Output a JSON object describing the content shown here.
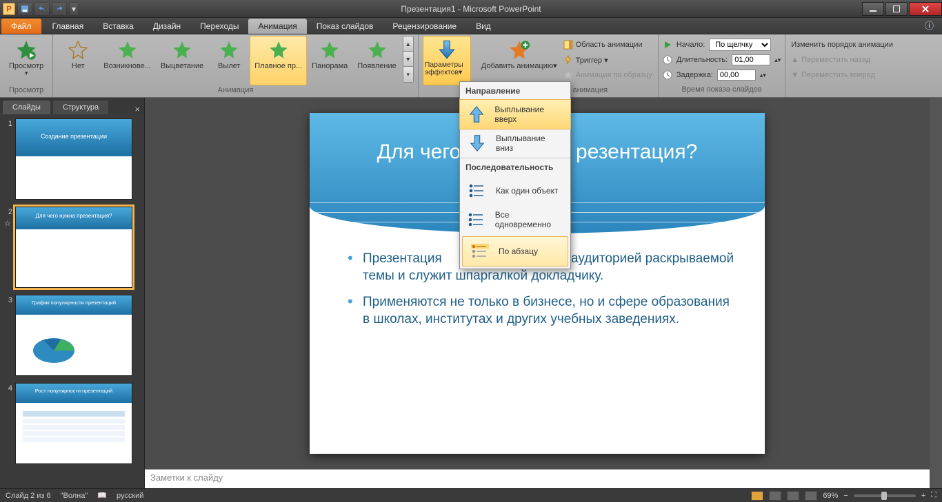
{
  "titlebar": {
    "title": "Презентация1 - Microsoft PowerPoint",
    "app_letter": "P"
  },
  "tabs": {
    "file": "Файл",
    "items": [
      "Главная",
      "Вставка",
      "Дизайн",
      "Переходы",
      "Анимация",
      "Показ слайдов",
      "Рецензирование",
      "Вид"
    ],
    "active_index": 4
  },
  "ribbon": {
    "preview": {
      "button": "Просмотр",
      "caption": "Просмотр"
    },
    "animation_group": {
      "caption": "Анимация",
      "items": [
        "Нет",
        "Возникнове...",
        "Выцветание",
        "Вылет",
        "Плавное пр...",
        "Панорама",
        "Появление"
      ],
      "active_index": 4
    },
    "effect_options": {
      "label": "Параметры эффектов▾"
    },
    "advanced": {
      "add": "Добавить анимацию▾",
      "pane": "Область анимации",
      "trigger": "Триггер ▾",
      "painter": "Анимация по образцу",
      "caption": "Расширенная анимация"
    },
    "timing": {
      "start_label": "Начало:",
      "start_value": "По щелчку",
      "duration_label": "Длительность:",
      "duration_value": "01,00",
      "delay_label": "Задержка:",
      "delay_value": "00,00",
      "caption": "Время показа слайдов"
    },
    "reorder": {
      "title": "Изменить порядок анимации",
      "earlier": "Переместить назад",
      "later": "Переместить вперед"
    }
  },
  "popup": {
    "section1": "Направление",
    "opt_up": "Выплывание вверх",
    "opt_down": "Выплывание вниз",
    "section2": "Последовательность",
    "opt_as_one": "Как один объект",
    "opt_all_at_once": "Все одновременно",
    "opt_by_paragraph": "По абзацу"
  },
  "slidepanel": {
    "tab_slides": "Слайды",
    "tab_outline": "Структура",
    "thumbs": [
      {
        "num": "1",
        "title": "Создание презентации"
      },
      {
        "num": "2",
        "title": "Для чего нужна презентация?"
      },
      {
        "num": "3",
        "title": "График популярности презентаций"
      },
      {
        "num": "4",
        "title": "Рост популярности презентаций"
      }
    ]
  },
  "slide": {
    "title": "Для чего нужна презентация?",
    "bullet1": "Презентация облетает понимание аудиторией раскрываемой темы и служит шпаргалкой докладчику.",
    "bullet2": "Применяются не только в бизнесе, но и сфере образования в школах, институтах и других учебных заведениях."
  },
  "notes": {
    "placeholder": "Заметки к слайду"
  },
  "status": {
    "slide_n": "Слайд 2 из 6",
    "theme": "\"Волна\"",
    "lang": "русский",
    "zoom": "69%"
  }
}
